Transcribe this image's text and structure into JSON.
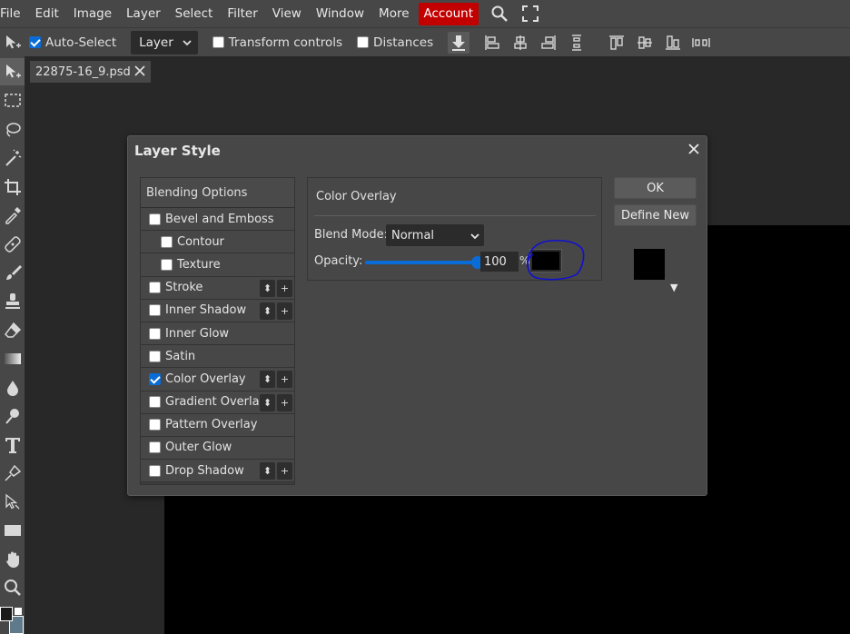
{
  "menu": {
    "items": [
      "File",
      "Edit",
      "Image",
      "Layer",
      "Select",
      "Filter",
      "View",
      "Window",
      "More"
    ],
    "account_label": "Account"
  },
  "options_bar": {
    "auto_select_label": "Auto-Select",
    "auto_select_checked": true,
    "target_select_value": "Layer",
    "transform_controls_label": "Transform controls",
    "distances_label": "Distances"
  },
  "document": {
    "tab_title": "22875-16_9.psd"
  },
  "dialog": {
    "title": "Layer Style",
    "blending_options_label": "Blending Options",
    "styles": [
      {
        "label": "Bevel and Emboss",
        "checked": false,
        "sub": false,
        "buttons": false
      },
      {
        "label": "Contour",
        "checked": false,
        "sub": true,
        "buttons": false
      },
      {
        "label": "Texture",
        "checked": false,
        "sub": true,
        "buttons": false
      },
      {
        "label": "Stroke",
        "checked": false,
        "sub": false,
        "buttons": true
      },
      {
        "label": "Inner Shadow",
        "checked": false,
        "sub": false,
        "buttons": true
      },
      {
        "label": "Inner Glow",
        "checked": false,
        "sub": false,
        "buttons": false
      },
      {
        "label": "Satin",
        "checked": false,
        "sub": false,
        "buttons": false
      },
      {
        "label": "Color Overlay",
        "checked": true,
        "sub": false,
        "buttons": true
      },
      {
        "label": "Gradient Overlay",
        "checked": false,
        "sub": false,
        "buttons": true
      },
      {
        "label": "Pattern Overlay",
        "checked": false,
        "sub": false,
        "buttons": false
      },
      {
        "label": "Outer Glow",
        "checked": false,
        "sub": false,
        "buttons": false
      },
      {
        "label": "Drop Shadow",
        "checked": false,
        "sub": false,
        "buttons": true
      }
    ],
    "row_button_move": "⬍",
    "row_button_add": "+",
    "panel": {
      "title": "Color Overlay",
      "blend_mode_label": "Blend Mode:",
      "blend_mode_value": "Normal",
      "opacity_label": "Opacity:",
      "opacity_value": "100",
      "opacity_fraction": 1.0,
      "percent_sign": "%",
      "overlay_color": "#000000"
    },
    "ok_label": "OK",
    "define_new_label": "Define New",
    "preview_color": "#000000"
  },
  "colors": {
    "accent": "#0a6cd6",
    "account_bg": "#c30000",
    "annotation": "#1010d0"
  }
}
